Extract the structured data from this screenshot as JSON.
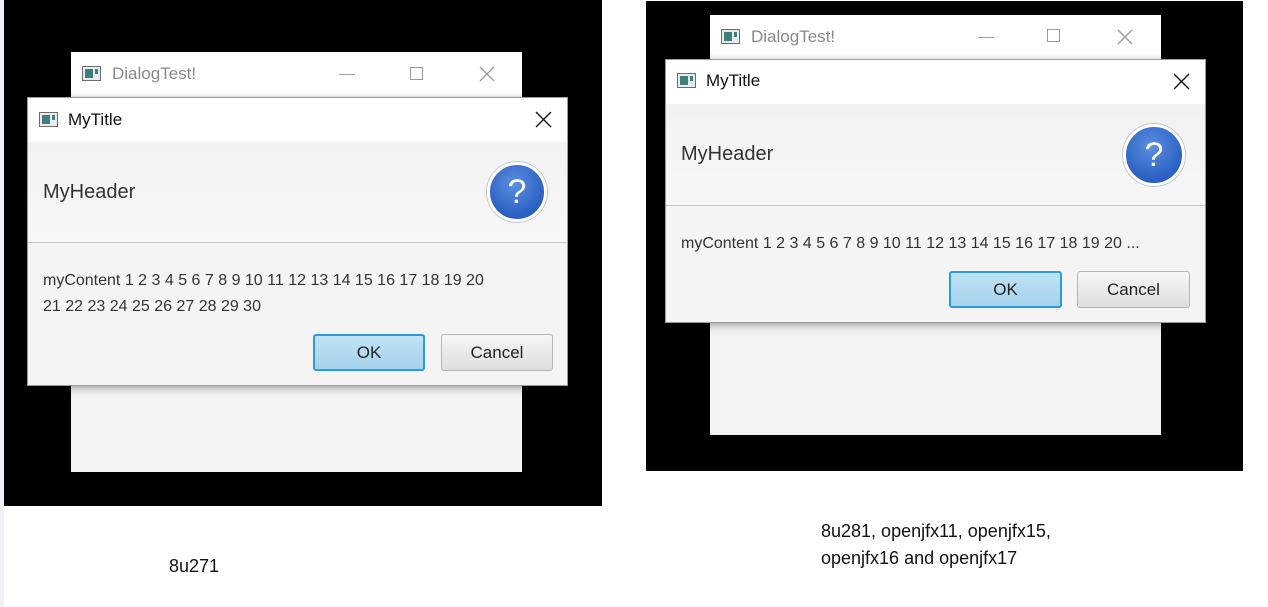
{
  "left": {
    "bg_window": {
      "title": "DialogTest!"
    },
    "dialog": {
      "title": "MyTitle",
      "header": "MyHeader",
      "content_line1": "myContent 1 2 3 4 5 6 7 8 9 10 11 12 13 14 15 16 17 18 19 20",
      "content_line2": "21 22 23 24 25 26 27 28 29 30",
      "ok_label": "OK",
      "cancel_label": "Cancel",
      "question_glyph": "?"
    },
    "caption": "8u271"
  },
  "right": {
    "bg_window": {
      "title": "DialogTest!"
    },
    "dialog": {
      "title": "MyTitle",
      "header": "MyHeader",
      "content": "myContent 1 2 3 4 5 6 7 8 9 10 11 12 13 14 15 16 17 18 19 20 ...",
      "ok_label": "OK",
      "cancel_label": "Cancel",
      "question_glyph": "?"
    },
    "caption_line1": "8u281, openjfx11, openjfx15,",
    "caption_line2": "openjfx16 and openjfx17"
  },
  "icons": [
    "app-icon",
    "minimize-icon",
    "maximize-icon",
    "close-icon",
    "question-icon"
  ],
  "colors": {
    "ok_border": "#2b9ae0",
    "question_blue": "#2a5fc4",
    "backdrop": "#000000"
  }
}
